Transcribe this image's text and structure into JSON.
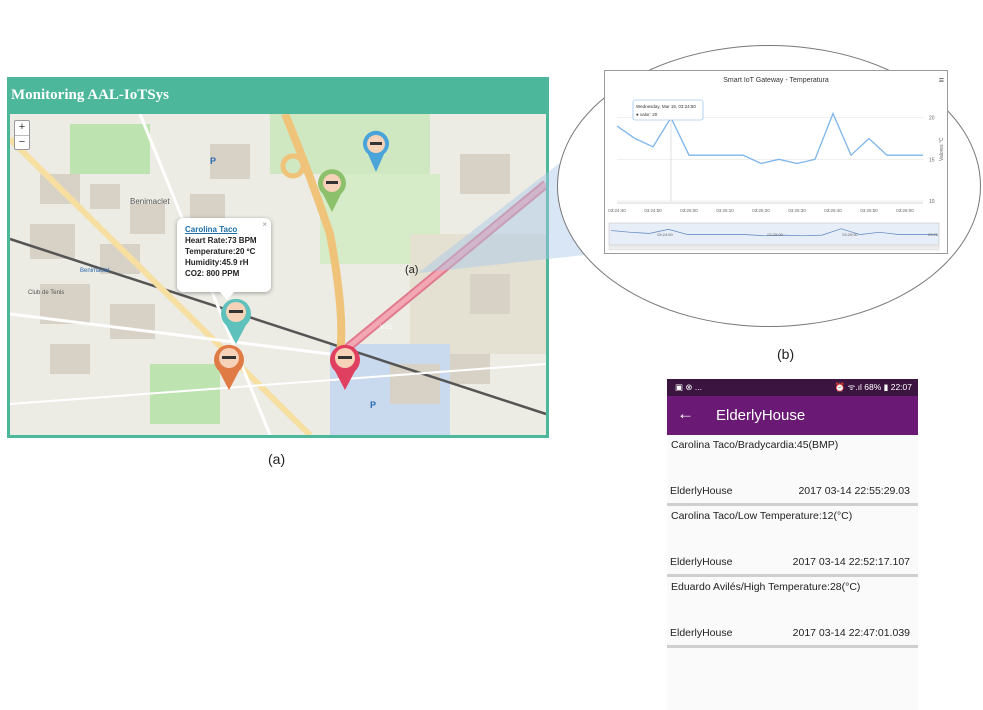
{
  "web": {
    "title": "Monitoring AAL-IoTSys",
    "zoom_in": "+",
    "zoom_out": "−",
    "map_callout": "(a)",
    "popup": {
      "close": "×",
      "name": "Carolina Taco",
      "heart_rate": "Heart Rate:73 BPM",
      "temperature": "Temperature:20 ºC",
      "humidity": "Humidity:45.9 rH",
      "co2": "CO2: 800 PPM"
    },
    "map_labels": [
      "Benimaclet",
      "Benimaclet",
      "Club de Tenis",
      "P",
      "P",
      "V-21"
    ]
  },
  "chart": {
    "menu_icon": "hamburger-menu-icon",
    "chart_data": {
      "type": "line",
      "title": "Smart IoT Gateway - Temperatura",
      "tooltip": [
        "Wednesday, Mar 15, 03:24:50",
        "● valor: 20"
      ],
      "x": [
        "03:24:40",
        "03:24:45",
        "03:24:50",
        "03:24:55",
        "03:25:00",
        "03:25:05",
        "03:25:10",
        "03:25:15",
        "03:25:20",
        "03:25:25",
        "03:25:30",
        "03:25:35",
        "03:25:40",
        "03:25:45",
        "03:25:50",
        "03:25:55",
        "03:26:00",
        "03:26:05"
      ],
      "values": [
        19,
        17.5,
        16.5,
        20,
        15.5,
        15.5,
        15.5,
        15.5,
        14.5,
        15,
        14.5,
        15,
        20.5,
        15.5,
        17.5,
        15.5,
        15.5,
        15.5
      ],
      "xtick_labels": [
        "03:24:40",
        "03:24:50",
        "03:25:00",
        "03:25:10",
        "03:25:20",
        "03:25:30",
        "03:25:40",
        "03:25:50",
        "03:26:00"
      ],
      "ytick_labels": [
        "20",
        "15",
        "10"
      ],
      "ylabel": "Valores °C",
      "ylim": [
        10,
        22
      ],
      "navigator_labels": [
        "03:24:50",
        "03:25:00",
        "03:25:50",
        "03:26"
      ]
    },
    "caption": "(b)"
  },
  "caption_a": "(a)",
  "phone": {
    "status_left": "▣ ⊗ ...",
    "status_right": "⏰ ᯤ.ıl 68% ▮ 22:07",
    "back_icon": "←",
    "title": "ElderlyHouse",
    "notifications": [
      {
        "message": "Carolina Taco/Bradycardia:45(BMP)",
        "source": "ElderlyHouse",
        "time": "2017 03-14   22:55:29.03"
      },
      {
        "message": "Carolina Taco/Low Temperature:12(°C)",
        "source": "ElderlyHouse",
        "time": "2017 03-14  22:52:17.107"
      },
      {
        "message": "Eduardo Avilés/High Temperature:28(°C)",
        "source": "ElderlyHouse",
        "time": "2017 03-14  22:47:01.039"
      }
    ]
  },
  "colors": {
    "header_teal": "#4db79b",
    "app_purple": "#6a1a74",
    "status_dark": "#3b1440",
    "chart_line": "#7cb5ec"
  }
}
